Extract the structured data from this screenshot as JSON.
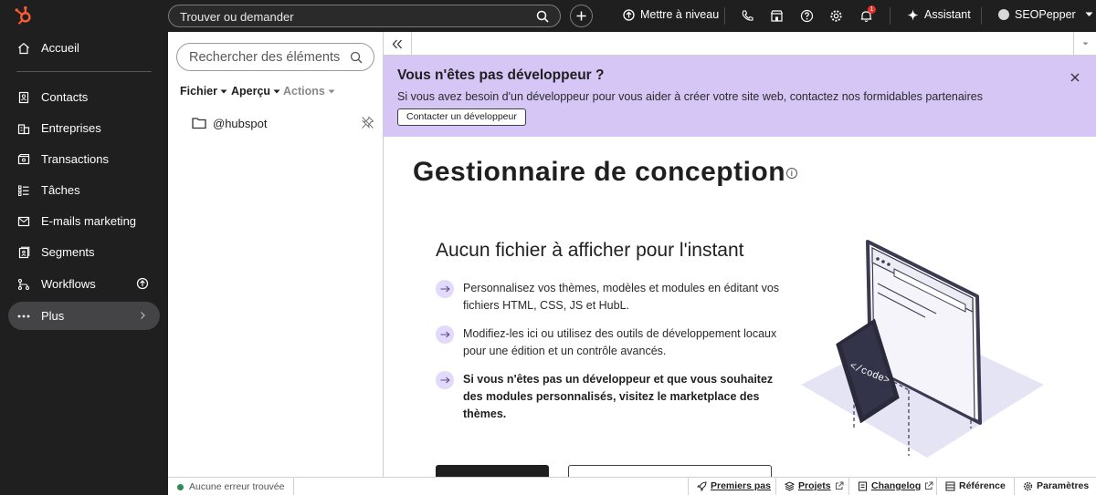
{
  "topbar": {
    "search_placeholder": "Trouver ou demander",
    "upgrade_label": "Mettre à niveau",
    "notification_count": "1",
    "assistant_label": "Assistant",
    "account_name": "SEOPepper"
  },
  "nav": {
    "home": "Accueil",
    "items": [
      {
        "label": "Contacts",
        "icon": "contacts-icon"
      },
      {
        "label": "Entreprises",
        "icon": "companies-icon"
      },
      {
        "label": "Transactions",
        "icon": "deals-icon"
      },
      {
        "label": "Tâches",
        "icon": "tasks-icon"
      },
      {
        "label": "E-mails marketing",
        "icon": "email-icon"
      },
      {
        "label": "Segments",
        "icon": "segments-icon"
      },
      {
        "label": "Workflows",
        "icon": "workflows-icon"
      },
      {
        "label": "Plus",
        "icon": "more-icon"
      }
    ]
  },
  "filepanel": {
    "search_placeholder": "Rechercher des éléments",
    "menu_file": "Fichier",
    "menu_preview": "Aperçu",
    "menu_actions": "Actions",
    "folder_name": "@hubspot"
  },
  "banner": {
    "title": "Vous n'êtes pas développeur ?",
    "text": "Si vous avez besoin d'un développeur pour vous aider à créer votre site web, contactez nos formidables partenaires",
    "button": "Contacter un développeur"
  },
  "main": {
    "title": "Gestionnaire de conception",
    "info_glyph": "i",
    "empty_heading": "Aucun fichier à afficher pour l'instant",
    "bullets": [
      "Personnalisez vos thèmes, modèles et modules en éditant vos fichiers HTML, CSS, JS et HubL.",
      "Modifiez-les ici ou utilisez des outils de développement locaux pour une édition et un contrôle avancés.",
      "Si vous n'êtes pas un développeur et que vous souhaitez des modules personnalisés, visitez le marketplace des thèmes."
    ],
    "illustration_code_label": "</code>"
  },
  "statusbar": {
    "status": "Aucune erreur trouvée",
    "links": {
      "getting_started": "Premiers pas",
      "projects": "Projets",
      "changelog": "Changelog",
      "reference": "Référence",
      "settings": "Paramètres"
    }
  },
  "colors": {
    "topbar_bg": "#1f1f1f",
    "banner_bg": "#d6c6f6",
    "bullet_bg": "#e3d9fa",
    "badge_red": "#e5322d",
    "status_ok": "#2e8b57"
  }
}
